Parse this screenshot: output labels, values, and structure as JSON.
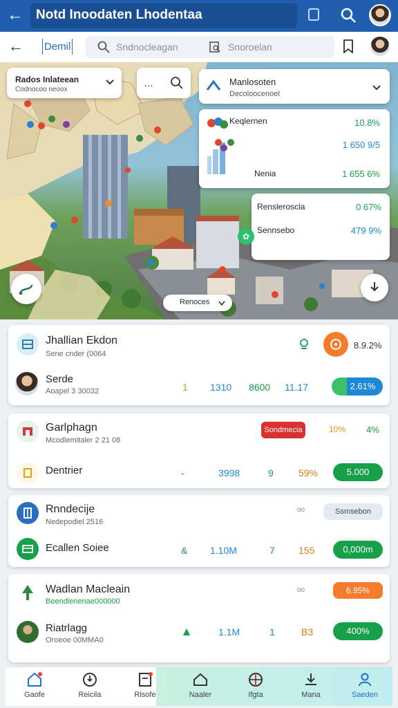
{
  "topbar": {
    "title": "Notd Inoodaten Lhodentaa"
  },
  "searchbar": {
    "tab_label": "Demil",
    "placeholder_primary": "Sndnocleagan",
    "placeholder_secondary": "Snoroelan"
  },
  "map": {
    "left_dropdown": {
      "title": "Rados Inlateean",
      "subtitle": "Codnocoo neoox"
    },
    "right_dropdown": {
      "title": "Manlosoten",
      "subtitle": "Decoloocenoel"
    },
    "location_chip": "Renoces",
    "popup_top": {
      "title": "Keqlernen",
      "value1": "10.8%",
      "value2": "1 650 9/5",
      "row_label": "Nenia",
      "row_value": "1 655 6%"
    },
    "popup_bottom": {
      "row1_label": "Rensleroscla",
      "row1_value": "0 67%",
      "row2_label": "Sennsebo",
      "row2_value": "479 9%"
    }
  },
  "cards": [
    {
      "title": "Jhallian Ekdon",
      "subtitle": "Sene cnder (0064",
      "badge_value": "8.9.2%",
      "row": {
        "name": "Serde",
        "sub": "Aoapel 3 30032",
        "c1": "1",
        "c2": "1310",
        "c3": "8600",
        "c4": "11.17",
        "pill": "2.61%"
      }
    },
    {
      "title": "Garlphagn",
      "subtitle": "Mcodlemitaler 2 21 08",
      "red_pill": "Sondmecia",
      "pct1": "10%",
      "pct2": "4%",
      "row": {
        "name": "Dentrier",
        "c1": "-",
        "c2": "3998",
        "c3": "9",
        "c4": "59%",
        "pill": "5.000"
      }
    },
    {
      "title": "Rnndecije",
      "subtitle": "Nedepodiel 2516",
      "dots": "oo",
      "grey_pill": "Ssmsebon",
      "row": {
        "name": "Ecallen Soiee",
        "c1": "&",
        "c2": "1.10M",
        "c3": "7",
        "c4": "155",
        "pill": "0,000m"
      }
    },
    {
      "title": "Wadlan Macleain",
      "subtitle": "Beendlenenae000000",
      "dots": "oo",
      "orange_pill": "6.95%",
      "row": {
        "name": "Riatrlagg",
        "sub": "Oroeoe 00MMA0",
        "c1": "",
        "c2": "1.1M",
        "c3": "1",
        "c4": "B3",
        "pill": "400%"
      }
    }
  ],
  "nav": [
    {
      "label": "Gaofe",
      "icon": "home-icon"
    },
    {
      "label": "Reicila",
      "icon": "compass-icon"
    },
    {
      "label": "Rlsofe",
      "icon": "document-icon"
    },
    {
      "label": "Naaler",
      "icon": "building-icon"
    },
    {
      "label": "Ifgta",
      "icon": "target-icon"
    },
    {
      "label": "Mana",
      "icon": "download-icon"
    },
    {
      "label": "Saeden",
      "icon": "person-icon"
    }
  ],
  "colors": {
    "header": "#1f5fae",
    "accent_green": "#17a04a",
    "accent_blue": "#1e88d8",
    "accent_red": "#d93030",
    "accent_orange": "#f47c2a"
  }
}
